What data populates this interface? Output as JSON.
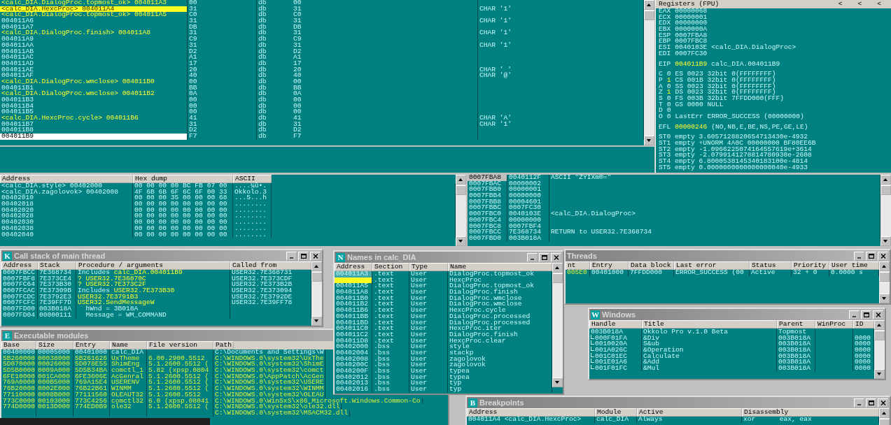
{
  "cpu": {
    "disasm_rows": [
      {
        "kind": "label",
        "text": "<calc_DIA.DialogProc.topmost_ok> 004011A3",
        "hex": "00",
        "mnemonic": "db",
        "operand": "00",
        "selected": false,
        "breakpoint": false
      },
      {
        "kind": "label",
        "text": "<calc_DIA.HexcProc> 004011A4",
        "hex": "31",
        "mnemonic": "db",
        "operand": "31",
        "comment": "CHAR '1'",
        "selected": false,
        "breakpoint": true
      },
      {
        "kind": "label",
        "text": "<calc_DIA.DialogProc.topmost_ok> 004011A5",
        "hex": "C0",
        "mnemonic": "db",
        "operand": "C0",
        "selected": false,
        "breakpoint": false
      },
      {
        "kind": "address",
        "text": "004011A6",
        "hex": "31",
        "mnemonic": "db",
        "operand": "31",
        "comment": "CHAR '1'",
        "selected": false,
        "breakpoint": false
      },
      {
        "kind": "address",
        "text": "004011A7",
        "hex": "DB",
        "mnemonic": "db",
        "operand": "DB",
        "selected": false,
        "breakpoint": false
      },
      {
        "kind": "label",
        "text": "<calc_DIA.DialogProc.finish> 004011A8",
        "hex": "31",
        "mnemonic": "db",
        "operand": "31",
        "comment": "CHAR '1'",
        "selected": false,
        "breakpoint": false
      },
      {
        "kind": "address",
        "text": "004011A9",
        "hex": "C9",
        "mnemonic": "db",
        "operand": "C9",
        "selected": false,
        "breakpoint": false
      },
      {
        "kind": "address",
        "text": "004011AA",
        "hex": "31",
        "mnemonic": "db",
        "operand": "31",
        "comment": "CHAR '1'",
        "selected": false,
        "breakpoint": false
      },
      {
        "kind": "address",
        "text": "004011AB",
        "hex": "D2",
        "mnemonic": "db",
        "operand": "D2",
        "selected": false,
        "breakpoint": false
      },
      {
        "kind": "address",
        "text": "004011AC",
        "hex": "A1",
        "mnemonic": "db",
        "operand": "A1",
        "selected": false,
        "breakpoint": false
      },
      {
        "kind": "address",
        "text": "004011AD",
        "hex": "17",
        "mnemonic": "db",
        "operand": "17",
        "selected": false,
        "breakpoint": false
      },
      {
        "kind": "address",
        "text": "004011AE",
        "hex": "20",
        "mnemonic": "db",
        "operand": "20",
        "comment": "CHAR ' '",
        "selected": false,
        "breakpoint": false
      },
      {
        "kind": "address",
        "text": "004011AF",
        "hex": "40",
        "mnemonic": "db",
        "operand": "40",
        "comment": "CHAR '@'",
        "selected": false,
        "breakpoint": false
      },
      {
        "kind": "label",
        "text": "<calc_DIA.DialogProc.wmclose> 004011B0",
        "hex": "00",
        "mnemonic": "db",
        "operand": "00",
        "selected": false,
        "breakpoint": false
      },
      {
        "kind": "address",
        "text": "004011B1",
        "hex": "BB",
        "mnemonic": "db",
        "operand": "BB",
        "selected": false,
        "breakpoint": false
      },
      {
        "kind": "label",
        "text": "<calc_DIA.DialogProc.wmclose> 004011B2",
        "hex": "0A",
        "mnemonic": "db",
        "operand": "0A",
        "selected": false,
        "breakpoint": false
      },
      {
        "kind": "address",
        "text": "004011B3",
        "hex": "00",
        "mnemonic": "db",
        "operand": "00",
        "selected": false,
        "breakpoint": false
      },
      {
        "kind": "address",
        "text": "004011B4",
        "hex": "00",
        "mnemonic": "db",
        "operand": "00",
        "selected": false,
        "breakpoint": false
      },
      {
        "kind": "address",
        "text": "004011B5",
        "hex": "00",
        "mnemonic": "db",
        "operand": "00",
        "selected": false,
        "breakpoint": false
      },
      {
        "kind": "label",
        "text": "<calc_DIA.HexcProc.cycle> 004011B6",
        "hex": "41",
        "mnemonic": "db",
        "operand": "41",
        "comment": "CHAR 'A'",
        "selected": false,
        "breakpoint": false
      },
      {
        "kind": "address",
        "text": "004011B7",
        "hex": "31",
        "mnemonic": "db",
        "operand": "31",
        "comment": "CHAR '1'",
        "selected": false,
        "breakpoint": false
      },
      {
        "kind": "address",
        "text": "004011B8",
        "hex": "D2",
        "mnemonic": "db",
        "operand": "D2",
        "selected": false,
        "breakpoint": false
      },
      {
        "kind": "address",
        "text": "004011B9",
        "hex": "F7",
        "mnemonic": "db",
        "operand": "F7",
        "selected": true,
        "breakpoint": false
      }
    ],
    "registers": {
      "title": "Registers (FPU)",
      "nav": [
        "<",
        "<",
        "<"
      ],
      "general": [
        {
          "name": "EAX",
          "value": "00000068",
          "changed": false
        },
        {
          "name": "ECX",
          "value": "00000001",
          "changed": false
        },
        {
          "name": "EDX",
          "value": "00000000",
          "changed": false
        },
        {
          "name": "EBX",
          "value": "0000000A",
          "changed": false
        },
        {
          "name": "ESP",
          "value": "0007FBA8",
          "changed": false
        },
        {
          "name": "EBP",
          "value": "0007FBC8",
          "changed": false
        },
        {
          "name": "ESI",
          "value": "0040103E",
          "changed": false,
          "comment": "<calc_DIA.DialogProc>"
        },
        {
          "name": "EDI",
          "value": "0007FC30",
          "changed": false
        }
      ],
      "eip": {
        "name": "EIP",
        "value": "004011B9",
        "changed": true,
        "comment": "calc_DIA.004011B9"
      },
      "flags": [
        {
          "flag": "C",
          "value": "0",
          "changed": false,
          "segment": "ES 0023 32bit 0(FFFFFFFF)"
        },
        {
          "flag": "P",
          "value": "1",
          "changed": true,
          "segment": "CS 001B 32bit 0(FFFFFFFF)"
        },
        {
          "flag": "A",
          "value": "0",
          "changed": false,
          "segment": "SS 0023 32bit 0(FFFFFFFF)"
        },
        {
          "flag": "Z",
          "value": "1",
          "changed": true,
          "segment": "DS 0023 32bit 0(FFFFFFFF)"
        },
        {
          "flag": "S",
          "value": "0",
          "changed": false,
          "segment": "FS 003B 32bit 7FFDD000(FFF)"
        },
        {
          "flag": "T",
          "value": "0",
          "changed": false,
          "segment": "GS 0000 NULL"
        },
        {
          "flag": "D",
          "value": "0",
          "changed": false
        },
        {
          "flag": "O",
          "value": "0",
          "changed": false,
          "segment": "LastErr ERROR_SUCCESS (00000000)"
        }
      ],
      "efl": {
        "name": "EFL",
        "value": "00000246",
        "changed": true,
        "comment": "(NO,NB,E,BE,NS,PE,GE,LE)"
      },
      "fpu": [
        "ST0 empty 3.6057128820654713430e-4932",
        "ST1 empty +UNORM 4A0C 00000000 BF80EE6B",
        "ST2 empty -1.0966225074164557619e+3614",
        "ST3 empty -2.0799141278814780930e-2608",
        "ST4 empty 6.8000538145340183100e-4814",
        "ST5 empty 0.0000000000000000040e-4933"
      ]
    }
  },
  "dump": {
    "columns": [
      "Address",
      "Hex dump",
      "ASCII"
    ],
    "rows": [
      {
        "address": "<calc_DIA.style> 00402000",
        "hex": "00 00 00 00 BC FB 07 00",
        "ascii": "....¼û•."
      },
      {
        "address": "<calc_DIA.zagolovok> 00402008",
        "hex": "4F 6B 6B 6F 6C 6F 00 33",
        "ascii": "Okkolo.3"
      },
      {
        "address": "00402010",
        "hex": "00 00 00 35 00 00 00 68",
        "ascii": "...5...h"
      },
      {
        "address": "00402018",
        "hex": "00 00 00 00 00 00 00 00",
        "ascii": "........"
      },
      {
        "address": "00402020",
        "hex": "00 00 00 00 00 00 00 00",
        "ascii": "........"
      },
      {
        "address": "00402028",
        "hex": "00 00 00 00 00 00 00 00",
        "ascii": "........"
      },
      {
        "address": "00402030",
        "hex": "00 00 00 00 00 00 00 00",
        "ascii": "........"
      },
      {
        "address": "00402038",
        "hex": "00 00 00 00 00 00 00 00",
        "ascii": "........"
      },
      {
        "address": "00402040",
        "hex": "00 00 00 00 00 00 00 00",
        "ascii": "........"
      }
    ]
  },
  "stack": {
    "rows": [
      {
        "address": "0007FBA8",
        "value": "0040112F",
        "comment": "ASCII \"ZYIXm®=\"",
        "selected": true
      },
      {
        "address": "0007FBAC",
        "value": "00000002",
        "selected": false
      },
      {
        "address": "0007FBB0",
        "value": "00000001",
        "selected": false
      },
      {
        "address": "0007FBB4",
        "value": "00000000",
        "selected": false
      },
      {
        "address": "0007FBB8",
        "value": "00004601",
        "selected": false
      },
      {
        "address": "0007FBBC",
        "value": "0007FC30",
        "selected": false
      },
      {
        "address": "0007FBC0",
        "value": "0040103E",
        "comment": "<calc_DIA.DialogProc>",
        "selected": false
      },
      {
        "address": "0007FBC4",
        "value": "00000000",
        "selected": false
      },
      {
        "address": "0007FBC8",
        "value": "0007FBF4",
        "selected": false
      },
      {
        "address": "0007FBCC",
        "value": "7E368734",
        "comment": "RETURN to USER32.7E368734",
        "selected": false
      },
      {
        "address": "0007FBD0",
        "value": "003B018A",
        "selected": false
      }
    ]
  },
  "call_stack": {
    "icon_letter": "K",
    "title": "Call stack of main thread",
    "columns": [
      "Address",
      "Stack",
      "Procedure / arguments",
      "Called from"
    ],
    "rows": [
      {
        "address": "0007FBCC",
        "stack": "7E368734",
        "prefix": "Includes",
        "proc": "calc_DIA.004011B9",
        "called_from": "USER32.7E368731"
      },
      {
        "address": "0007FBF8",
        "stack": "7E373CE4",
        "proc": "? USER32.7E36870C",
        "called_from": "USER32.7E373CDF"
      },
      {
        "address": "0007FC64",
        "stack": "7E373B30",
        "proc": "? USER32.7E373C2F",
        "called_from": "USER32.7E373B2B"
      },
      {
        "address": "0007FCAC",
        "stack": "7E37309B",
        "prefix": "Includes",
        "proc": "USER32.7E373B30",
        "called_from": "USER32.7E373094"
      },
      {
        "address": "0007FCDC",
        "stack": "7E3792E3",
        "proc": "USER32.7E3791B3",
        "called_from": "USER32.7E3792DE"
      },
      {
        "address": "0007FCFC",
        "stack": "7E39FF7D",
        "proc": "USER32.SendMessageW",
        "called_from": "USER32.7E39FF78"
      },
      {
        "address": "0007FD00",
        "stack": "003B018A",
        "arg": "hWnd = 3B018A"
      },
      {
        "address": "0007FD04",
        "stack": "00000111",
        "arg": "Message = WM_COMMAND"
      }
    ]
  },
  "modules": {
    "icon_letter": "E",
    "title": "Executable modules",
    "columns": [
      "Base",
      "Size",
      "Entry",
      "Name",
      "File version",
      "Path"
    ],
    "rows": [
      {
        "base": "00400000",
        "size": "00005000",
        "entry": "00401000",
        "name": "calc_DIA",
        "path": "C:\\Documents and Settings\\W",
        "system": false
      },
      {
        "base": "5B260000",
        "size": "00038000",
        "entry": "5B261626",
        "name": "UxTheme",
        "version": "6.00.2900.5512",
        "path": "C:\\WINDOWS.0\\system32\\UxThe",
        "system": true
      },
      {
        "base": "5D070000",
        "size": "00026000",
        "entry": "5D078E55",
        "name": "ShimEng",
        "version": "5.1.2600.5512 (",
        "path": "C:\\WINDOWS.0\\system32\\ShimE",
        "system": true
      },
      {
        "base": "5D5B0000",
        "size": "0009A000",
        "entry": "5D5B34BA",
        "name": "comctl_1",
        "version": "5.82 (xpsp.0804",
        "path": "C:\\WINDOWS.0\\system32\\comct",
        "system": true
      },
      {
        "base": "6FE10000",
        "size": "001CA000",
        "entry": "6FE3606E",
        "name": "AcGenral",
        "version": "5.1.2600.5512 (",
        "path": "C:\\WINDOWS.0\\AppPatch\\AcGen",
        "system": true
      },
      {
        "base": "769A0000",
        "size": "000B5000",
        "entry": "769A15E4",
        "name": "USERENV",
        "version": "5.1.2600.5512 (",
        "path": "C:\\WINDOWS.0\\system32\\USERE",
        "system": true
      },
      {
        "base": "76B20000",
        "size": "0002E000",
        "entry": "76B22B61",
        "name": "WINMM",
        "version": "5.1.2600.5512 (",
        "path": "C:\\WINDOWS.0\\system32\\WINMM",
        "system": true
      },
      {
        "base": "77110000",
        "size": "0008B000",
        "entry": "77111560",
        "name": "OLEAUT32",
        "version": "5.1.2600.5512",
        "path": "C:\\WINDOWS.0\\system32\\OLEAU",
        "system": true
      },
      {
        "base": "773C0000",
        "size": "00103000",
        "entry": "773C4256",
        "name": "comctl32",
        "version": "6.0 (xpsp.08041",
        "path": "C:\\WINDOWS.0\\WinSxS\\x86_Microsoft.Windows.Common-Co",
        "system": true
      },
      {
        "base": "774D0000",
        "size": "0013D000",
        "entry": "774ED0B9",
        "name": "ole32",
        "version": "5.1.2600.5512 (",
        "path": "C:\\WINDOWS.0\\system32\\ole32.dll",
        "system": true
      },
      {
        "path": "C:\\WINDOWS.0\\system32\\MSACM32.dll",
        "system": true
      }
    ]
  },
  "names": {
    "icon_letter": "N",
    "title": "Names in calc_DIA",
    "columns": [
      "Address",
      "Section",
      "Type",
      "Name"
    ],
    "rows": [
      {
        "address": "004011A3",
        "section": ".text",
        "type": "User",
        "name": "DialogProc.topmost_ok",
        "selected": true,
        "breakpoint": false
      },
      {
        "section": ".text",
        "type": "User",
        "name": "HexcProc",
        "selected": false,
        "breakpoint": true
      },
      {
        "address": "004011A5",
        "section": ".text",
        "type": "User",
        "name": "DialogProc.topmost_ok",
        "selected": false,
        "breakpoint": false
      },
      {
        "address": "004011A8",
        "section": ".text",
        "type": "User",
        "name": "DialogProc.finish",
        "selected": false,
        "breakpoint": false
      },
      {
        "address": "004011B0",
        "section": ".text",
        "type": "User",
        "name": "DialogProc.wmclose",
        "selected": false,
        "breakpoint": false
      },
      {
        "address": "004011B2",
        "section": ".text",
        "type": "User",
        "name": "DialogProc.wmclose",
        "selected": false,
        "breakpoint": false
      },
      {
        "address": "004011B6",
        "section": ".text",
        "type": "User",
        "name": "HexcProc.cycle",
        "selected": false,
        "breakpoint": false
      },
      {
        "address": "004011BB",
        "section": ".text",
        "type": "User",
        "name": "DialogProc.processed",
        "selected": false,
        "breakpoint": false
      },
      {
        "address": "004011BD",
        "section": ".text",
        "type": "User",
        "name": "DialogProc.processed",
        "selected": false,
        "breakpoint": false
      },
      {
        "address": "004011C0",
        "section": ".text",
        "type": "User",
        "name": "HexcProc.iter",
        "selected": false,
        "breakpoint": false
      },
      {
        "address": "004011C2",
        "section": ".text",
        "type": "User",
        "name": "DialogProc.finish",
        "selected": false,
        "breakpoint": false
      },
      {
        "address": "004011D8",
        "section": ".text",
        "type": "User",
        "name": "HexcProc.clear",
        "selected": false,
        "breakpoint": false
      },
      {
        "address": "00402000",
        "section": ".bss",
        "type": "User",
        "name": "style",
        "selected": false,
        "breakpoint": false
      },
      {
        "address": "00402004",
        "section": ".bss",
        "type": "User",
        "name": "stackp",
        "selected": false,
        "breakpoint": false
      },
      {
        "address": "00402008",
        "section": ".bss",
        "type": "User",
        "name": "zagolovok",
        "selected": false,
        "breakpoint": false
      },
      {
        "address": "0040200C",
        "section": ".bss",
        "type": "User",
        "name": "zagolovok",
        "selected": false,
        "breakpoint": false
      },
      {
        "address": "0040200F",
        "section": ".bss",
        "type": "User",
        "name": "typea",
        "selected": false,
        "breakpoint": false
      },
      {
        "address": "00402012",
        "section": ".bss",
        "type": "User",
        "name": "typea",
        "selected": false,
        "breakpoint": false
      },
      {
        "address": "00402013",
        "section": ".bss",
        "type": "User",
        "name": "typ",
        "selected": false,
        "breakpoint": false
      },
      {
        "address": "00402016",
        "section": ".bss",
        "type": "User",
        "name": "typ",
        "selected": false,
        "breakpoint": false
      }
    ]
  },
  "threads": {
    "title": "Threads",
    "columns": [
      "nt",
      "Entry",
      "Data block",
      "Last error",
      "Status",
      "Priority",
      "User time"
    ],
    "rows": [
      {
        "ident": "005E0",
        "entry": "00401000",
        "data_block": "7FFDD000",
        "last_error": "ERROR_SUCCESS (00",
        "status": "Active",
        "priority": "32 + 0",
        "user_time": "0.0000 s"
      }
    ]
  },
  "windows": {
    "icon_letter": "W",
    "title": "Windows",
    "columns": [
      "Handle",
      "Title",
      "Parent",
      "WinProc",
      "ID"
    ],
    "rows": [
      {
        "handle": "003B018A",
        "title": "Okkolo Pro v.1.0 Beta",
        "parent": "Topmost",
        "children": [
          {
            "handle": "000F01FA",
            "title": "&Div",
            "parent": "003B018A",
            "id": "0000"
          },
          {
            "handle": "0010020A",
            "title": "S&ub",
            "parent": "003B018A",
            "id": "0000"
          },
          {
            "handle": "001A026C",
            "title": "&Operation",
            "parent": "003B018A",
            "id": "0000"
          },
          {
            "handle": "001C01EC",
            "title": "Calculate",
            "parent": "003B018A",
            "id": "0000"
          },
          {
            "handle": "001E01A6",
            "title": "&Add",
            "parent": "003B018A",
            "id": "0000"
          },
          {
            "handle": "001F01FC",
            "title": "&Mul",
            "parent": "003B018A",
            "id": "0000"
          }
        ]
      }
    ]
  },
  "breakpoints": {
    "icon_letter": "B",
    "title": "Breakpoints",
    "columns": [
      "Address",
      "Module",
      "Active",
      "Disassembly"
    ],
    "rows": [
      {
        "address": "004011A4 <calc_DIA.HexcProc>",
        "module": "calc_DIA",
        "active": "Always",
        "mnemonic": "xor",
        "operands": "eax, eax"
      }
    ]
  }
}
